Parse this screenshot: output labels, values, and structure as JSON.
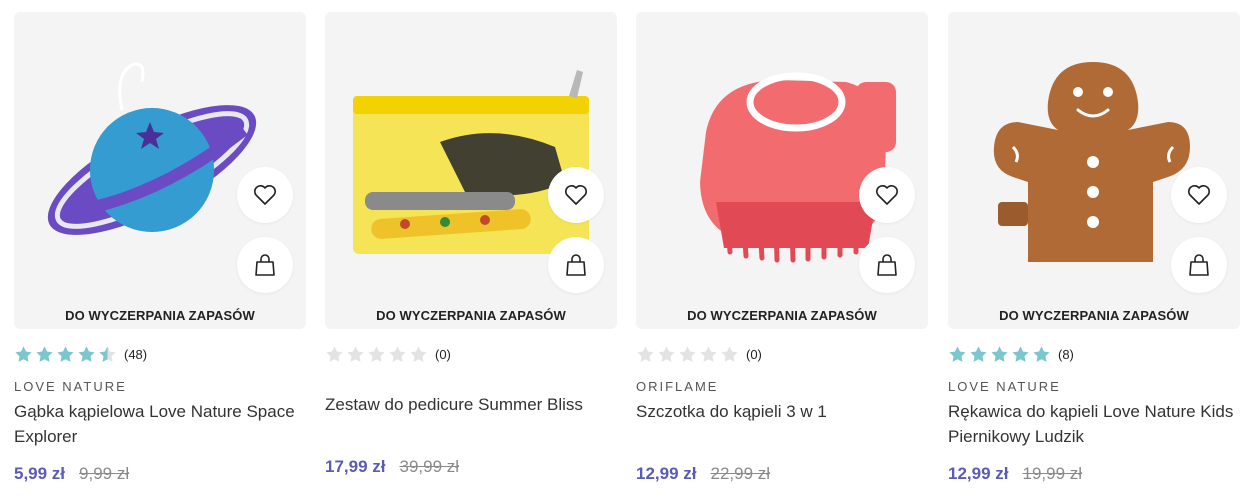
{
  "labels": {
    "stock": "DO WYCZERPANIA ZAPASÓW"
  },
  "colors": {
    "star_filled": "#7cc6cf",
    "star_empty": "#e3e3e3",
    "price_accent": "#5a5bb5"
  },
  "products": [
    {
      "brand": "LOVE NATURE",
      "name": "Gąbka kąpielowa Love Nature Space Explorer",
      "rating": 4.5,
      "reviews": "(48)",
      "price": "5,99 zł",
      "old_price": "9,99 zł",
      "icons": [
        "heart-icon",
        "shopping-bag-icon"
      ]
    },
    {
      "brand": "",
      "name": "Zestaw do pedicure Summer Bliss",
      "rating": 0,
      "reviews": "(0)",
      "price": "17,99 zł",
      "old_price": "39,99 zł",
      "icons": [
        "heart-icon",
        "shopping-bag-icon"
      ]
    },
    {
      "brand": "ORIFLAME",
      "name": "Szczotka do kąpieli 3 w 1",
      "rating": 0,
      "reviews": "(0)",
      "price": "12,99 zł",
      "old_price": "22,99 zł",
      "icons": [
        "heart-icon",
        "shopping-bag-icon"
      ]
    },
    {
      "brand": "LOVE NATURE",
      "name": "Rękawica do kąpieli Love Nature Kids Piernikowy Ludzik",
      "rating": 5,
      "reviews": "(8)",
      "price": "12,99 zł",
      "old_price": "19,99 zł",
      "icons": [
        "heart-icon",
        "shopping-bag-icon"
      ]
    }
  ]
}
